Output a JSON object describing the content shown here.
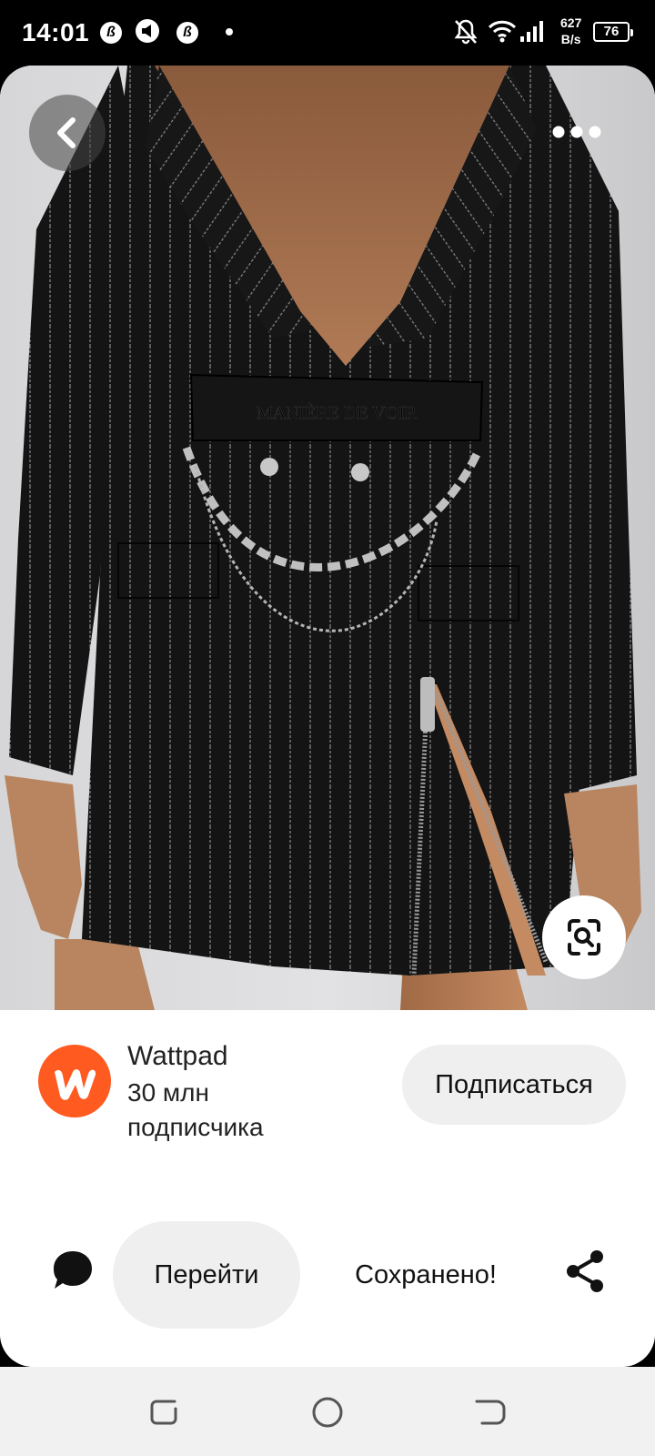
{
  "status_bar": {
    "time": "14:01",
    "notif_icons": [
      "b-circle-icon",
      "megaphone-icon",
      "b-circle-icon"
    ],
    "net_speed_value": "627",
    "net_speed_unit": "B/s",
    "battery": "76"
  },
  "photo": {
    "belt_text": "MANIÈRE DE VOIR"
  },
  "creator": {
    "name": "Wattpad",
    "subscribers": "30 млн подписчика",
    "subscribe_label": "Подписаться",
    "avatar_color": "#ff5a1f"
  },
  "actions": {
    "go_label": "Перейти",
    "saved_label": "Сохранено!"
  }
}
